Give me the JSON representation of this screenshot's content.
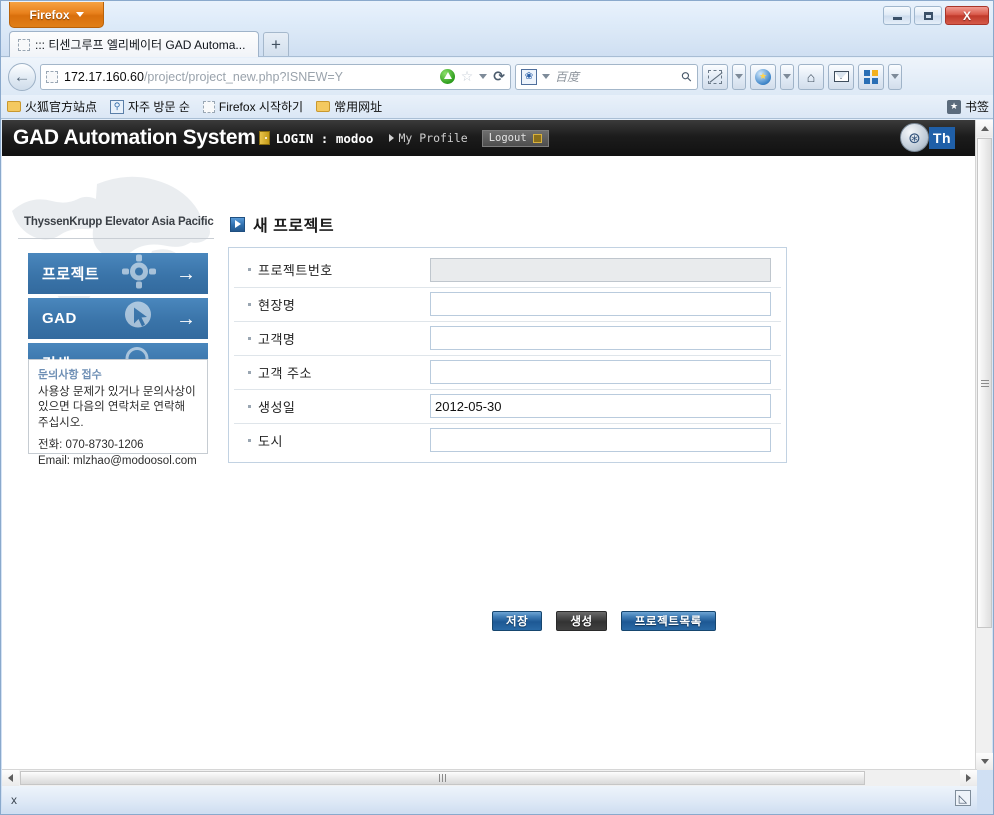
{
  "browser": {
    "firefox_button": "Firefox",
    "tab": {
      "title": "::: 티센그루프 엘리베이터 GAD Automa...",
      "new_tab_label": "+"
    },
    "url": {
      "domain": "172.17.160.60",
      "path": "/project/project_new.php?ISNEW=Y",
      "full": "172.17.160.60/project/project_new.php?ISNEW=Y"
    },
    "search": {
      "engine": "百度",
      "placeholder": "百度"
    },
    "bookmarks": [
      {
        "label": "火狐官方站点",
        "icon": "folder-icon"
      },
      {
        "label": "자주 방문 순",
        "icon": "magnifier-icon"
      },
      {
        "label": "Firefox 시작하기",
        "icon": "blank-favicon"
      },
      {
        "label": "常用网址",
        "icon": "folder-icon"
      }
    ],
    "bookmarks_right_label": "书签",
    "window_controls": {
      "minimize": "minimize",
      "maximize": "maximize",
      "close": "X"
    }
  },
  "site": {
    "title": "GAD Automation System",
    "login_label": "LOGIN : modoo",
    "profile_link": "My Profile",
    "logout_label": "Logout",
    "logo_word": "Th",
    "brand_line": "ThyssenKrupp Elevator Asia Pacific"
  },
  "sidebar": {
    "items": [
      {
        "label": "프로젝트",
        "icon": "gear-icon"
      },
      {
        "label": "GAD",
        "icon": "cursor-icon"
      },
      {
        "label": "검색",
        "icon": "magnifier-icon"
      }
    ],
    "contact": {
      "title": "문의사항 접수",
      "body_line1": "사용상 문제가 있거나 문의사상이",
      "body_line2": "있으면 다음의 연락처로 연락해",
      "body_line3": "주십시오.",
      "phone": "전화: 070-8730-1206",
      "email": "Email: mlzhao@modoosol.com"
    }
  },
  "main": {
    "page_title": "새 프로젝트",
    "form": {
      "fields": [
        {
          "label": "프로젝트번호",
          "value": "",
          "readonly": true
        },
        {
          "label": "현장명",
          "value": "",
          "readonly": false
        },
        {
          "label": "고객명",
          "value": "",
          "readonly": false
        },
        {
          "label": "고객 주소",
          "value": "",
          "readonly": false
        },
        {
          "label": "생성일",
          "value": "2012-05-30",
          "readonly": false
        },
        {
          "label": "도시",
          "value": "",
          "readonly": false
        }
      ]
    },
    "buttons": [
      {
        "label": "저장",
        "style": "blue"
      },
      {
        "label": "생성",
        "style": "gray"
      },
      {
        "label": "프로젝트목록",
        "style": "blue"
      }
    ]
  },
  "status": {
    "left_text": "x"
  },
  "colors": {
    "accent_blue": "#3a74a9",
    "site_bar": "#1c1c1c",
    "button_blue": "#1d5894",
    "button_gray": "#333333",
    "firefox_orange": "#e8801c"
  }
}
